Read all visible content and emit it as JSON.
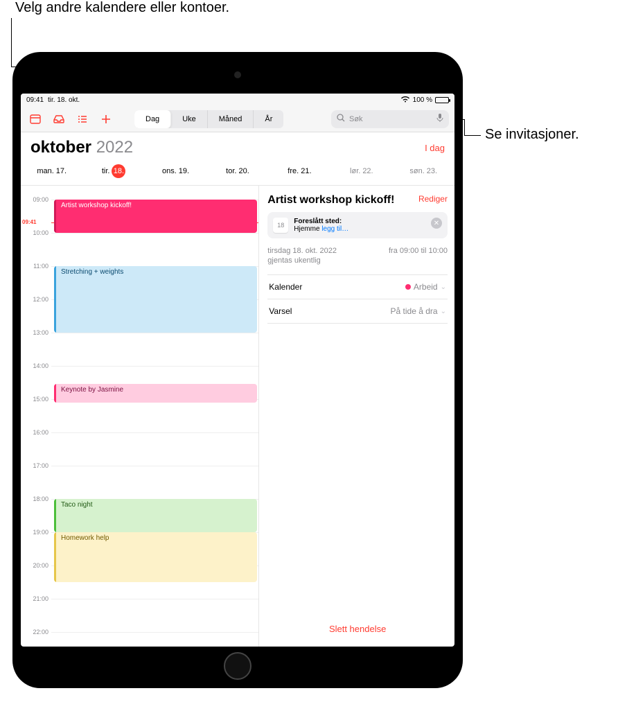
{
  "callouts": {
    "top": "Velg andre kalendere eller kontoer.",
    "right": "Se invitasjoner."
  },
  "statusbar": {
    "time": "09:41",
    "date": "tir. 18. okt.",
    "battery": "100 %"
  },
  "toolbar": {
    "segmented": [
      "Dag",
      "Uke",
      "Måned",
      "År"
    ],
    "search_placeholder": "Søk"
  },
  "header": {
    "month": "oktober",
    "year": "2022",
    "today": "I dag"
  },
  "weekdays": [
    {
      "abbr": "man.",
      "num": "17.",
      "selected": false,
      "weekend": false
    },
    {
      "abbr": "tir.",
      "num": "18.",
      "selected": true,
      "weekend": false
    },
    {
      "abbr": "ons.",
      "num": "19.",
      "selected": false,
      "weekend": false
    },
    {
      "abbr": "tor.",
      "num": "20.",
      "selected": false,
      "weekend": false
    },
    {
      "abbr": "fre.",
      "num": "21.",
      "selected": false,
      "weekend": false
    },
    {
      "abbr": "lør.",
      "num": "22.",
      "selected": false,
      "weekend": true
    },
    {
      "abbr": "søn.",
      "num": "23.",
      "selected": false,
      "weekend": true
    }
  ],
  "hours": [
    "09:00",
    "10:00",
    "11:00",
    "12:00",
    "13:00",
    "14:00",
    "15:00",
    "16:00",
    "17:00",
    "18:00",
    "19:00",
    "20:00",
    "21:00",
    "22:00"
  ],
  "now_label": "09:41",
  "events": [
    {
      "title": "Artist workshop kickoff!",
      "start": 9,
      "end": 10,
      "cls": "ev-pink"
    },
    {
      "title": "Stretching + weights",
      "start": 11,
      "end": 13,
      "cls": "ev-blue"
    },
    {
      "title": "Keynote by Jasmine",
      "start": 14.55,
      "end": 15.1,
      "cls": "ev-rose"
    },
    {
      "title": "Taco night",
      "start": 18,
      "end": 19,
      "cls": "ev-green"
    },
    {
      "title": "Homework help",
      "start": 19,
      "end": 20.5,
      "cls": "ev-yellow"
    }
  ],
  "detail": {
    "title": "Artist workshop kickoff!",
    "edit": "Rediger",
    "suggest_badge": "18",
    "suggest_label": "Foreslått sted:",
    "suggest_home": "Hjemme",
    "suggest_link": "legg til…",
    "date_text": "tirsdag 18. okt. 2022",
    "time_text": "fra 09:00 til 10:00",
    "repeat_text": "gjentas ukentlig",
    "rows": {
      "calendar_label": "Kalender",
      "calendar_value": "Arbeid",
      "calendar_color": "#ff2d71",
      "alert_label": "Varsel",
      "alert_value": "På tide å dra"
    },
    "delete": "Slett hendelse"
  }
}
